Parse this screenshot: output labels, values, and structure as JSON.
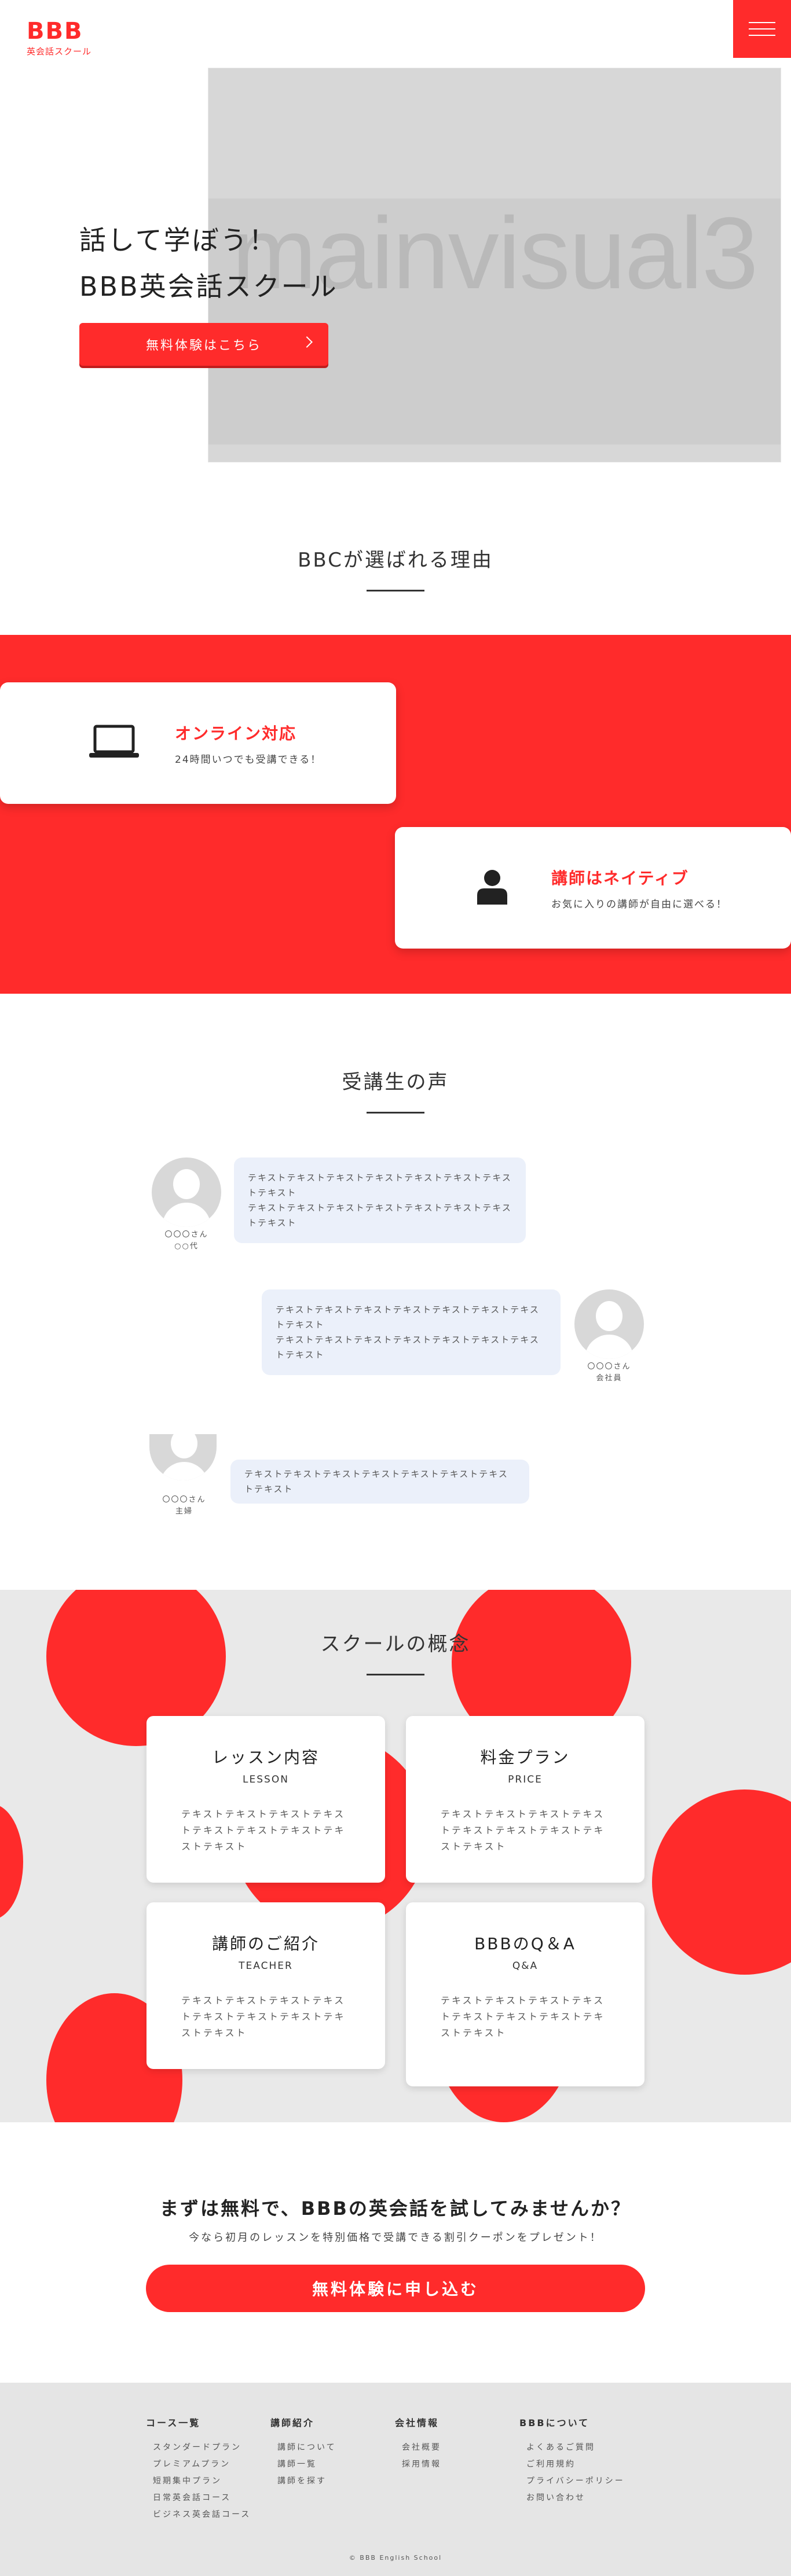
{
  "header": {
    "logo_main": "BBB",
    "logo_sub": "英会話スクール"
  },
  "hero": {
    "visual_text": "mainvisual3",
    "title_line1": "話して学ぼう！",
    "title_line2": "BBB英会話スクール",
    "cta_label": "無料体験はこちら"
  },
  "reasons": {
    "title": "BBCが選ばれる理由",
    "items": [
      {
        "title": "オンライン対応",
        "sub": "24時間いつでも受講できる！",
        "icon": "laptop-icon"
      },
      {
        "title": "講師はネイティブ",
        "sub": "お気に入りの講師が自由に選べる！",
        "icon": "person-icon"
      }
    ]
  },
  "voices": {
    "title": "受講生の声",
    "items": [
      {
        "name": "〇〇〇さん",
        "job": "○○代",
        "text_line1": "テキストテキストテキストテキストテキストテキストテキストテキスト",
        "text_line2": "テキストテキストテキストテキストテキストテキストテキストテキスト"
      },
      {
        "name": "〇〇〇さん",
        "job": "会社員",
        "text_line1": "テキストテキストテキストテキストテキストテキストテキストテキスト",
        "text_line2": "テキストテキストテキストテキストテキストテキストテキストテキスト"
      },
      {
        "name": "〇〇〇さん",
        "job": "主婦",
        "text_line1": "テキストテキストテキストテキストテキストテキストテキストテキスト",
        "text_line2": ""
      }
    ]
  },
  "concept": {
    "title": "スクールの概念",
    "cards": [
      {
        "title": "レッスン内容",
        "en": "LESSON",
        "body": "テキストテキストテキストテキストテキストテキストテキストテキストテキスト"
      },
      {
        "title": "料金プラン",
        "en": "PRICE",
        "body": "テキストテキストテキストテキストテキストテキストテキストテキストテキスト"
      },
      {
        "title": "講師のご紹介",
        "en": "TEACHER",
        "body": "テキストテキストテキストテキストテキストテキストテキストテキストテキスト"
      },
      {
        "title": "BBBのQ＆A",
        "en": "Q&A",
        "body": "テキストテキストテキストテキストテキストテキストテキストテキストテキスト"
      }
    ]
  },
  "cta": {
    "title": "まずは無料で、BBBの英会話を試してみませんか？",
    "sub": "今なら初月のレッスンを特別価格で受講できる割引クーポンをプレゼント！",
    "button": "無料体験に申し込む"
  },
  "footer": {
    "columns": [
      {
        "heading": "コース一覧",
        "items": [
          "スタンダードプラン",
          "プレミアムプラン",
          "短期集中プラン",
          "日常英会話コース",
          "ビジネス英会話コース"
        ]
      },
      {
        "heading": "講師紹介",
        "items": [
          "講師について",
          "講師一覧",
          "講師を探す"
        ]
      },
      {
        "heading": "会社情報",
        "items": [
          "会社概要",
          "採用情報"
        ]
      },
      {
        "heading": "BBBについて",
        "items": [
          "よくあるご質問",
          "ご利用規約",
          "プライバシーポリシー",
          "お問い合わせ"
        ]
      }
    ],
    "copyright": "© BBB English School"
  },
  "colors": {
    "accent": "#ff2b2b",
    "bubble": "#ebf0fa",
    "concept_bg": "#e9e9e9",
    "footer_bg": "#e5e5e5"
  }
}
